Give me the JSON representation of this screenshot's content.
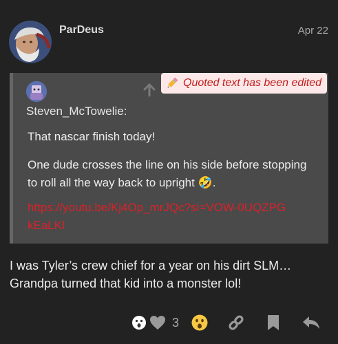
{
  "post": {
    "username": "ParDeus",
    "date": "Apr 22",
    "body": "I was Tyler’s crew chief for a year on his dirt SLM… Grandpa turned that kid into a monster lol!"
  },
  "quote": {
    "author": "Steven_McTowelie:",
    "edited_label": "Quoted text has been edited",
    "lines": [
      "That nascar finish today!",
      "One dude crosses the line on his side before stopping to roll all the way back to upright 🤣.",
      "https://youtu.be/Kj4Op_mrJQc?si=VOW-0UQZPGkEaLKl"
    ]
  },
  "actions": {
    "like_count": "3"
  },
  "colors": {
    "background": "#222222",
    "quote_bg": "#4a4a4a",
    "link": "#d9222a",
    "edited_badge_bg": "#fce8e8",
    "edited_text": "#c21d1d",
    "muted": "#a9a9a9"
  },
  "icons": {
    "edit": "pencil-icon",
    "go_to_quoted": "arrow-up-icon",
    "reaction_surprise": "open-mouth-emoji-icon",
    "like": "heart-icon",
    "reaction": "astonished-emoji-icon",
    "share": "link-icon",
    "bookmark": "bookmark-icon",
    "reply": "reply-icon"
  }
}
